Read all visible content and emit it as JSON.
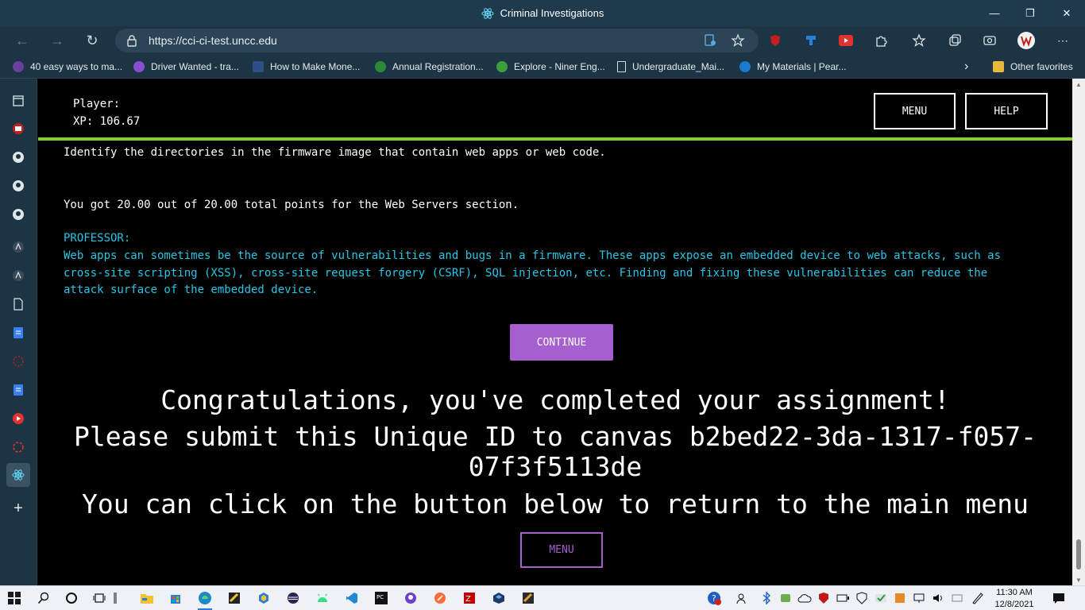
{
  "window": {
    "title": "Criminal Investigations",
    "minimize": "—",
    "maximize": "❐",
    "close": "✕"
  },
  "browser": {
    "url": "https://cci-ci-test.uncc.edu",
    "favorites": [
      {
        "label": "40 easy ways to ma...",
        "color": "#6b3fa0"
      },
      {
        "label": "Driver Wanted - tra...",
        "color": "#8a4fd0"
      },
      {
        "label": "How to Make Mone...",
        "color": "#2b4f86"
      },
      {
        "label": "Annual Registration...",
        "color": "#2a8a3a"
      },
      {
        "label": "Explore - Niner Eng...",
        "color": "#3aa03a"
      },
      {
        "label": "Undergraduate_Mai...",
        "color": "#dddddd"
      },
      {
        "label": "My Materials | Pear...",
        "color": "#1a7ad0"
      }
    ],
    "other_favorites": "Other favorites"
  },
  "game": {
    "player_label": "Player:",
    "xp_label": "XP: 106.67",
    "menu_button": "MENU",
    "help_button": "HELP",
    "task_text": "Identify the directories in the firmware image that contain web apps or web code.",
    "score_text": "You got 20.00 out of 20.00 total points for the Web Servers section.",
    "professor_label": "PROFESSOR:",
    "professor_line1": "Web apps can sometimes be the source of vulnerabilities and bugs in a firmware. These apps expose an embedded device to web attacks, such as",
    "professor_line2": "cross-site scripting (XSS), cross-site request forgery (CSRF), SQL injection, etc. Finding and fixing these vulnerabilities can reduce the",
    "professor_line3": "attack surface of the embedded device.",
    "continue_button": "CONTINUE",
    "congrats": "Congratulations, you've completed your assignment!",
    "submit_line1": "Please submit this Unique ID to canvas b2bed22-3da-1317-f057-",
    "submit_line2": "07f3f5113de",
    "return_text": "You can click on the button below to return to the main menu",
    "bottom_menu_button": "MENU",
    "colors": {
      "accent_green": "#7cd320",
      "professor_cyan": "#29c5e6",
      "purple": "#a65fcf"
    }
  },
  "taskbar": {
    "time": "11:30 AM",
    "date": "12/8/2021"
  }
}
